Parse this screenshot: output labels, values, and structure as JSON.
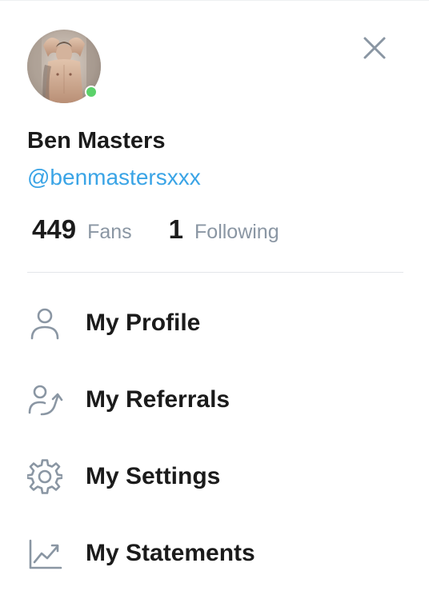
{
  "profile": {
    "display_name": "Ben Masters",
    "handle": "@benmastersxxx",
    "online": true,
    "online_color": "#5bd26a"
  },
  "stats": {
    "fans_count": "449",
    "fans_label": "Fans",
    "following_count": "1",
    "following_label": "Following"
  },
  "menu": {
    "items": [
      {
        "label": "My Profile",
        "icon": "user-icon"
      },
      {
        "label": "My Referrals",
        "icon": "referrals-icon"
      },
      {
        "label": "My Settings",
        "icon": "gear-icon"
      },
      {
        "label": "My Statements",
        "icon": "chart-line-icon"
      }
    ]
  },
  "colors": {
    "accent": "#3aa4e6",
    "muted_text": "#8a96a3",
    "icon": "#8a96a3"
  },
  "icons": {
    "close": "close-icon"
  }
}
